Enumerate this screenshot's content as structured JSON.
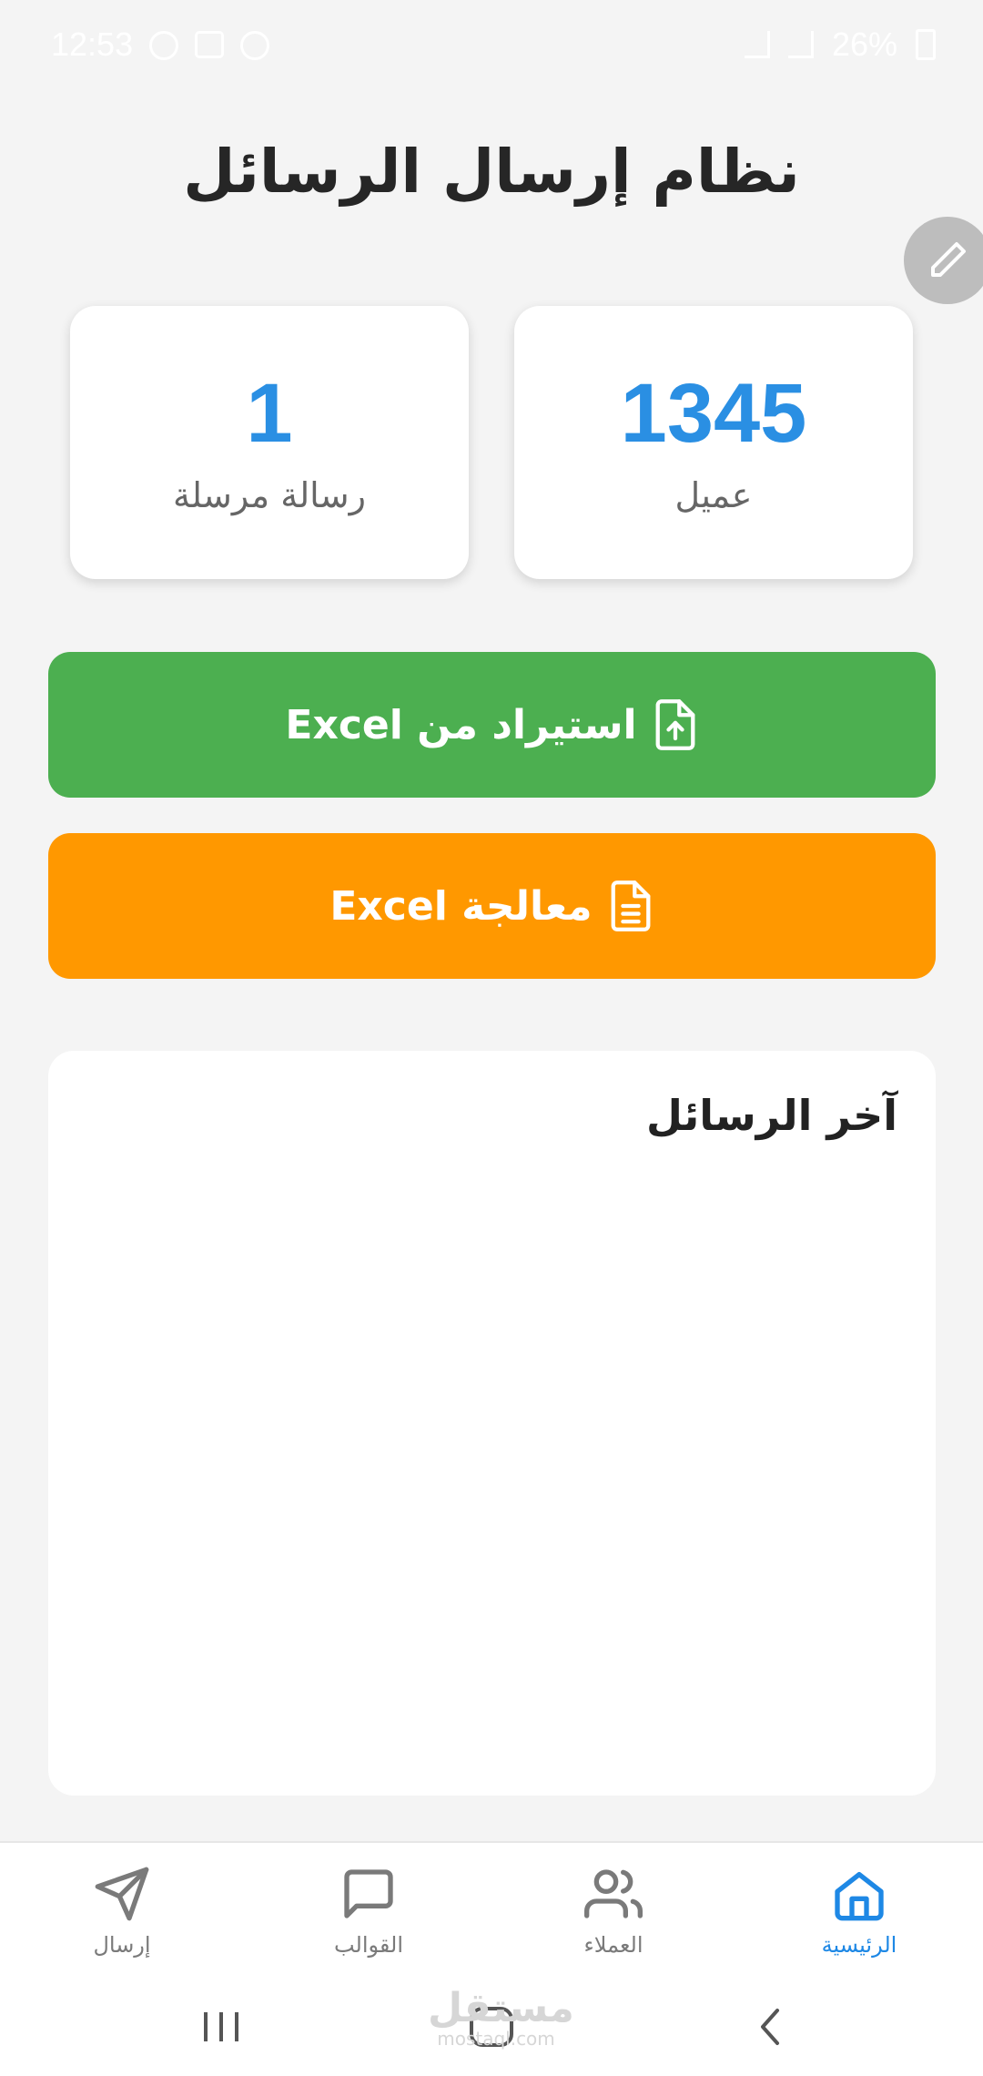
{
  "status_bar": {
    "time": "12:53",
    "battery": "26%"
  },
  "header": {
    "title": "نظام إرسال الرسائل"
  },
  "stats": [
    {
      "value": "1345",
      "label": "عميل"
    },
    {
      "value": "1",
      "label": "رسالة مرسلة"
    }
  ],
  "actions": {
    "import_label": "استيراد من Excel",
    "process_label": "معالجة Excel",
    "import_color": "#4caf50",
    "process_color": "#ff9800"
  },
  "recent_messages": {
    "title": "آخر الرسائل"
  },
  "bottom_nav": {
    "items": [
      {
        "label": "الرئيسية",
        "icon": "home-icon",
        "active": true
      },
      {
        "label": "العملاء",
        "icon": "users-icon",
        "active": false
      },
      {
        "label": "القوالب",
        "icon": "message-square-icon",
        "active": false
      },
      {
        "label": "إرسال",
        "icon": "send-icon",
        "active": false
      }
    ]
  },
  "watermark": {
    "text": "مستقل",
    "subtext": "mostaql.com"
  },
  "colors": {
    "accent": "#1e88e5",
    "stat_value": "#2a8fe3",
    "background": "#f4f4f4"
  }
}
